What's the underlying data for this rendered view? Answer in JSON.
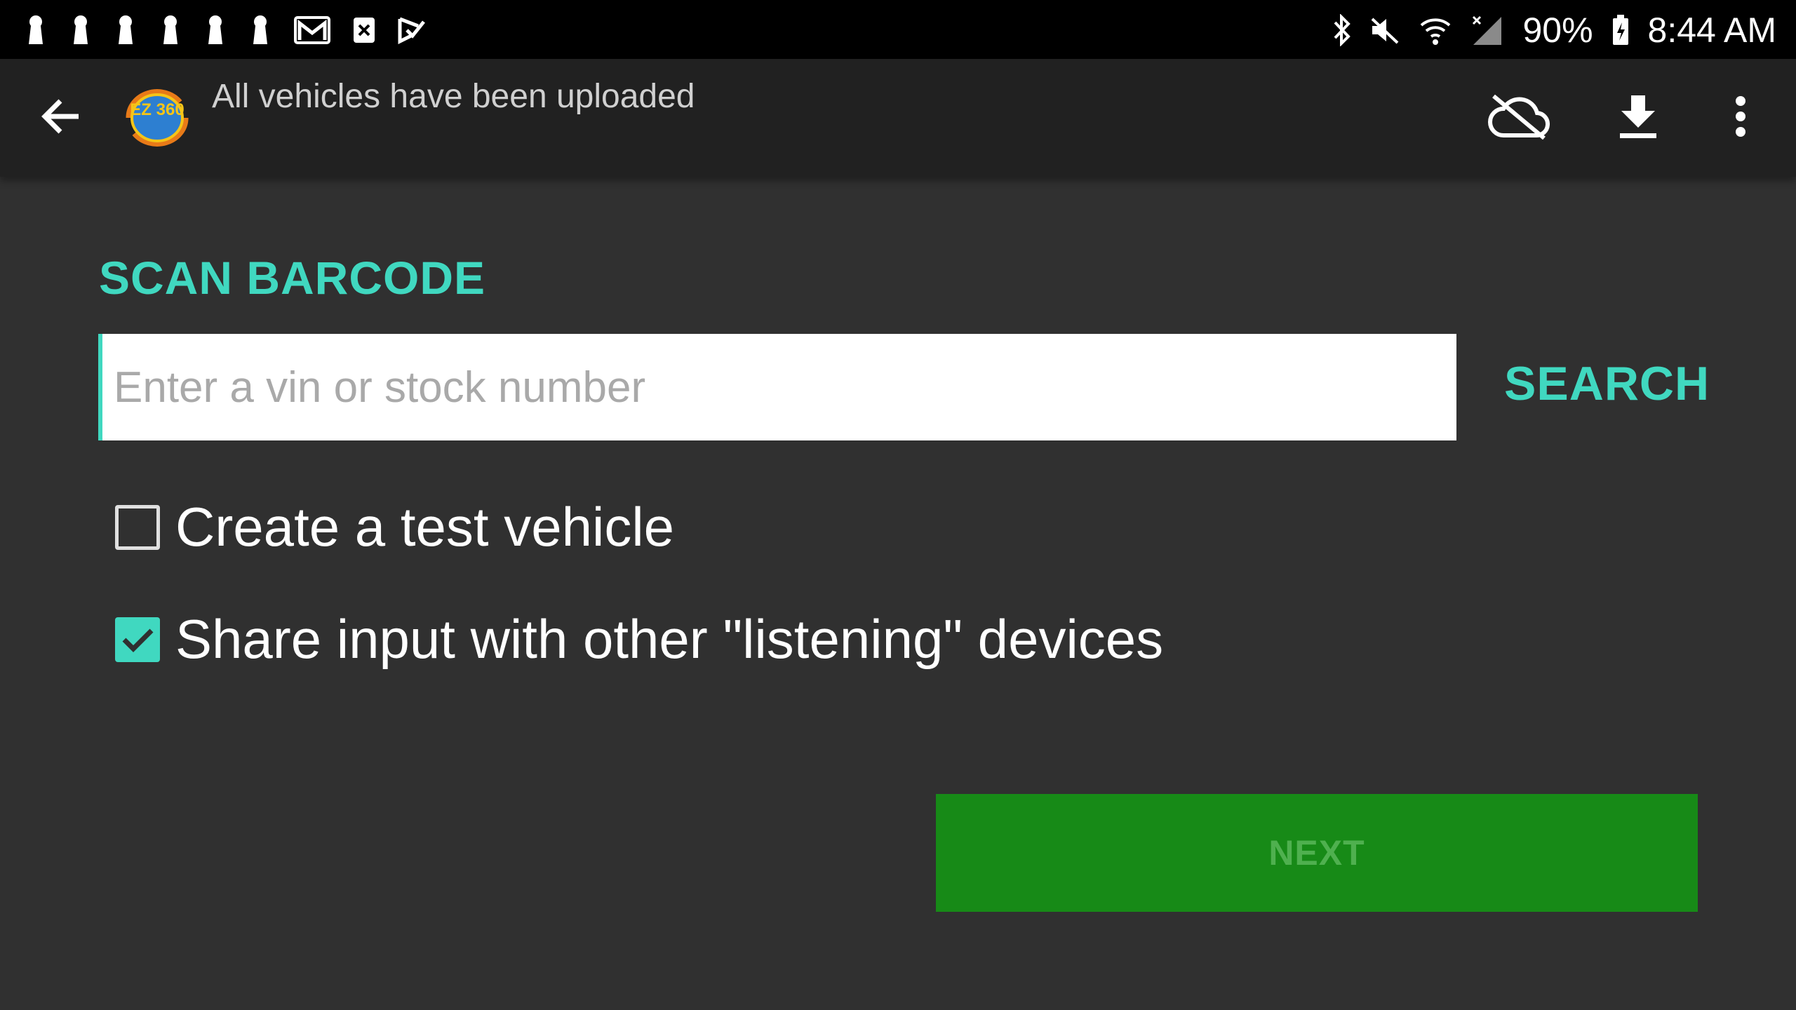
{
  "status_bar": {
    "notifications": [
      "keyhole-icon",
      "keyhole-icon",
      "keyhole-icon",
      "keyhole-icon",
      "keyhole-icon",
      "keyhole-icon",
      "gmail-icon",
      "close-box-icon",
      "check-flag-icon"
    ],
    "battery": "90%",
    "time": "8:44 AM"
  },
  "toolbar": {
    "logo_text": "EZ 360",
    "subtitle": "All vehicles have been uploaded"
  },
  "form": {
    "section_title": "SCAN BARCODE",
    "vin_placeholder": "Enter a vin or stock number",
    "vin_value": "",
    "search_label": "SEARCH",
    "test_vehicle_label": "Create a test vehicle",
    "test_vehicle_checked": false,
    "share_input_label": "Share input with other \"listening\" devices",
    "share_input_checked": true,
    "next_label": "NEXT",
    "next_enabled": false
  },
  "colors": {
    "accent": "#40d8c0",
    "next_button": "#178a17",
    "background": "#303030",
    "toolbar": "#212121"
  }
}
